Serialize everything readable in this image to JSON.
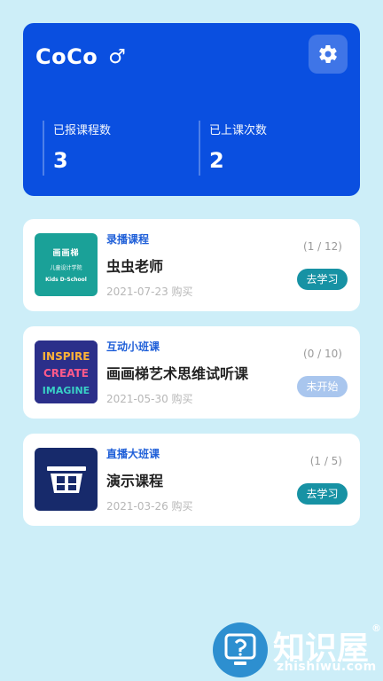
{
  "profile": {
    "name": "CoCo",
    "gender_symbol": "♂",
    "stats": [
      {
        "label": "已报课程数",
        "value": "3"
      },
      {
        "label": "已上课次数",
        "value": "2"
      }
    ]
  },
  "courses": [
    {
      "type": "录播课程",
      "title": "虫虫老师",
      "date": "2021-07-23 购买",
      "progress": "(1 / 12)",
      "button": "去学习",
      "thumb_text": {
        "line1": "画画梯",
        "line2": "儿童设计学院",
        "line3": "Kids D-School"
      }
    },
    {
      "type": "互动小班课",
      "title": "画画梯艺术思维试听课",
      "date": "2021-05-30 购买",
      "progress": "(0 / 10)",
      "button": "未开始",
      "thumb_text": {
        "w1": "INSPIRE",
        "w2": "CREATE",
        "w3": "IMAGINE"
      }
    },
    {
      "type": "直播大班课",
      "title": "演示课程",
      "date": "2021-03-26 购买",
      "progress": "(1 / 5)",
      "button": "去学习"
    }
  ],
  "watermark": {
    "main": "知识屋",
    "sub": "zhishiwu.com",
    "reg": "®"
  },
  "colors": {
    "accent": "#0a4fe0",
    "button": "#1792a4",
    "button_disabled": "#a9c6ee",
    "background": "#cdeef8"
  }
}
